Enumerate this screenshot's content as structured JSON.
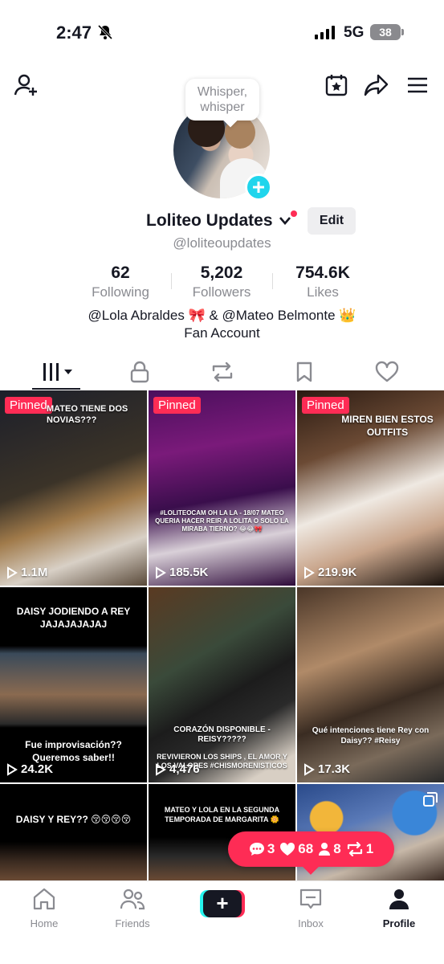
{
  "status_bar": {
    "time": "2:47",
    "network": "5G",
    "battery": "38"
  },
  "tooltip": {
    "line1": "Whisper,",
    "line2": "whisper"
  },
  "profile": {
    "name": "Loliteo Updates",
    "handle": "@loliteoupdates",
    "edit_label": "Edit",
    "following": "62",
    "following_label": "Following",
    "followers": "5,202",
    "followers_label": "Followers",
    "likes": "754.6K",
    "likes_label": "Likes",
    "bio_line1": "@Lola Abraldes 🎀 & @Mateo Belmonte 👑",
    "bio_line2": "Fan Account"
  },
  "videos": [
    {
      "pinned": "Pinned",
      "views": "1.1M",
      "caption": "MATEO TIENE DOS NOVIAS???"
    },
    {
      "pinned": "Pinned",
      "views": "185.5K",
      "caption": "#LOLITEOCAM OH LA LA - 18/07 MATEO QUERIA HACER REIR A LOLITA O SOLO LA MIRABA TIERNO? 😂😂🎀"
    },
    {
      "pinned": "Pinned",
      "views": "219.9K",
      "caption": "MIREN BIEN ESTOS OUTFITS"
    },
    {
      "pinned": "",
      "views": "24.2K",
      "caption": "DAISY JODIENDO A REY JAJAJAJAJAJ",
      "caption2": "Fue improvisación?? Queremos saber!!"
    },
    {
      "pinned": "",
      "views": "4,476",
      "caption": "CORAZÓN DISPONIBLE - REISY?????",
      "caption2": "REVIVIERON LOS SHIPS , EL AMOR Y LOS VALORES #CHISMORENISTICOS"
    },
    {
      "pinned": "",
      "views": "17.3K",
      "caption": "Qué intenciones tiene Rey con Daisy?? #Reisy"
    },
    {
      "pinned": "",
      "views": "",
      "caption": "DAISY Y REY?? 😚😚😚😚"
    },
    {
      "pinned": "",
      "views": "",
      "caption": "MATEO Y LOLA EN LA SEGUNDA TEMPORADA DE MARGARITA 🌼"
    },
    {
      "pinned": "",
      "views": "",
      "caption": ""
    }
  ],
  "notification": {
    "comments": "3",
    "likes": "68",
    "followers": "8",
    "reposts": "1"
  },
  "bottom_nav": {
    "home": "Home",
    "friends": "Friends",
    "inbox": "Inbox",
    "profile": "Profile"
  },
  "colors": {
    "accent": "#fe2c55",
    "cyan": "#25f4ee",
    "text": "#161823",
    "muted": "#8a8b91"
  }
}
